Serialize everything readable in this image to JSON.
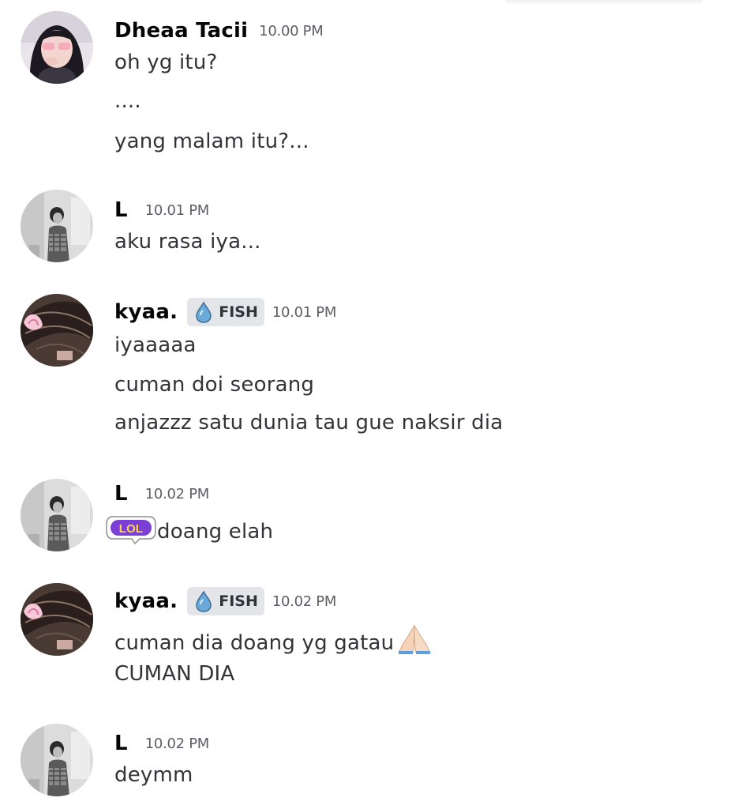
{
  "messages": [
    {
      "author": "Dheaa Tacii",
      "time": "10.00 PM",
      "lines": [
        "oh yg itu?",
        "....",
        "yang malam itu?..."
      ]
    },
    {
      "author": "L",
      "time": "10.01 PM",
      "lines": [
        "aku rasa iya..."
      ]
    },
    {
      "author": "kyaa.",
      "tag": "FISH",
      "time": "10.01 PM",
      "lines": [
        "iyaaaaa",
        "cuman doi seorang",
        "anjazzz satu dunia tau gue naksir dia"
      ]
    },
    {
      "author": "L",
      "time": "10.02 PM",
      "sticker": "LOL",
      "lines": [
        "doang elah"
      ]
    },
    {
      "author": "kyaa.",
      "tag": "FISH",
      "time": "10.02 PM",
      "lines": [
        "cuman dia doang yg gatau",
        "CUMAN DIA"
      ],
      "emoji": "folded-hands-icon"
    },
    {
      "author": "L",
      "time": "10.02 PM",
      "lines": [
        "deymm"
      ]
    }
  ],
  "colors": {
    "author": "#060607",
    "text": "#313338",
    "timestamp": "#5c5e66",
    "tag_bg": "#e3e5e8",
    "lol_purple": "#7b3fd6"
  }
}
